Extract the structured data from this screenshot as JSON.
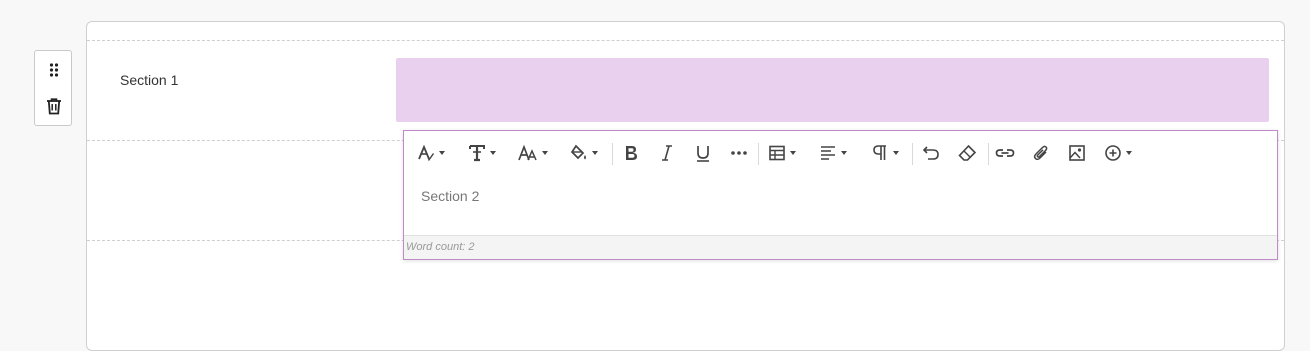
{
  "side_toolbar": {
    "drag_icon": "drag-handle-icon",
    "delete_icon": "trash-icon"
  },
  "section1": {
    "label": "Section 1",
    "highlight_color": "#ead0ef"
  },
  "editor": {
    "border_color": "#c08ac9",
    "toolbar": [
      {
        "name": "font-color-icon",
        "dropdown": true
      },
      {
        "name": "text-style-icon",
        "dropdown": true
      },
      {
        "name": "font-size-icon",
        "dropdown": true
      },
      {
        "name": "fill-color-icon",
        "dropdown": true
      },
      {
        "name": "bold-icon",
        "dropdown": false
      },
      {
        "name": "italic-icon",
        "dropdown": false
      },
      {
        "name": "underline-icon",
        "dropdown": false
      },
      {
        "name": "more-icon",
        "dropdown": false
      },
      {
        "name": "table-icon",
        "dropdown": true
      },
      {
        "name": "align-icon",
        "dropdown": true
      },
      {
        "name": "paragraph-icon",
        "dropdown": true
      },
      {
        "name": "undo-icon",
        "dropdown": false
      },
      {
        "name": "eraser-icon",
        "dropdown": false
      },
      {
        "name": "link-icon",
        "dropdown": false
      },
      {
        "name": "attachment-icon",
        "dropdown": false
      },
      {
        "name": "image-icon",
        "dropdown": false
      },
      {
        "name": "insert-icon",
        "dropdown": true
      }
    ],
    "content": "Section 2",
    "word_count": "Word count: 2"
  }
}
